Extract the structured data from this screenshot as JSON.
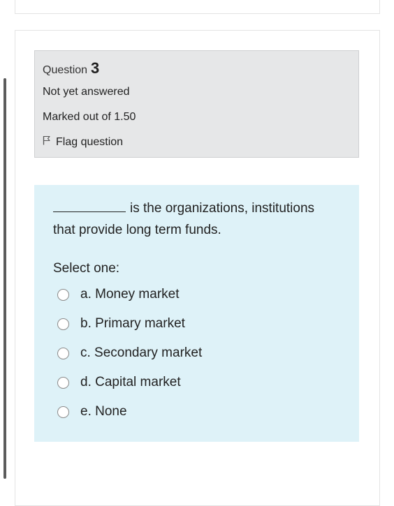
{
  "question": {
    "label": "Question",
    "number": "3",
    "status": "Not yet answered",
    "marks": "Marked out of 1.50",
    "flag_label": "Flag question"
  },
  "prompt": {
    "line1": "is the organizations, institutions",
    "line2": "that provide long term funds.",
    "select_one": "Select one:"
  },
  "options": [
    {
      "text": "a. Money market"
    },
    {
      "text": "b. Primary market"
    },
    {
      "text": "c. Secondary market"
    },
    {
      "text": "d. Capital market"
    },
    {
      "text": "e. None"
    }
  ]
}
